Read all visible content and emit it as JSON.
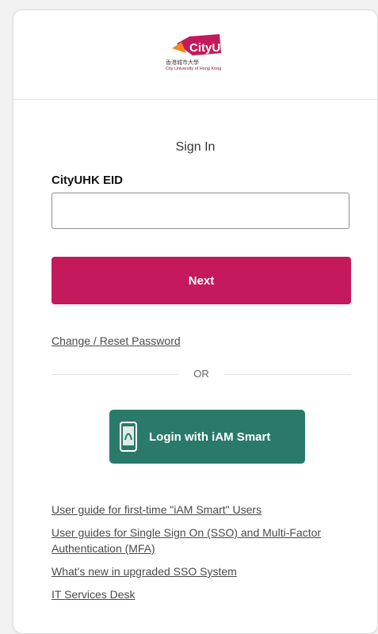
{
  "header": {
    "logo_word": "CityU",
    "logo_cn": "香港城市大學",
    "logo_en": "City University of Hong Kong"
  },
  "signin": {
    "title": "Sign In",
    "eid_label": "CityUHK EID",
    "eid_value": "",
    "next_label": "Next",
    "reset_link": "Change / Reset Password",
    "or_text": "OR"
  },
  "iam": {
    "label": "Login with iAM Smart",
    "color": "#2a7a6a"
  },
  "links": [
    "User guide for first-time \"iAM Smart\" Users",
    "User guides for Single Sign On (SSO) and Multi-Factor Authentication (MFA)",
    "What's new in upgraded SSO System",
    "IT Services Desk"
  ],
  "colors": {
    "primary": "#c4195a",
    "text": "#333333"
  }
}
